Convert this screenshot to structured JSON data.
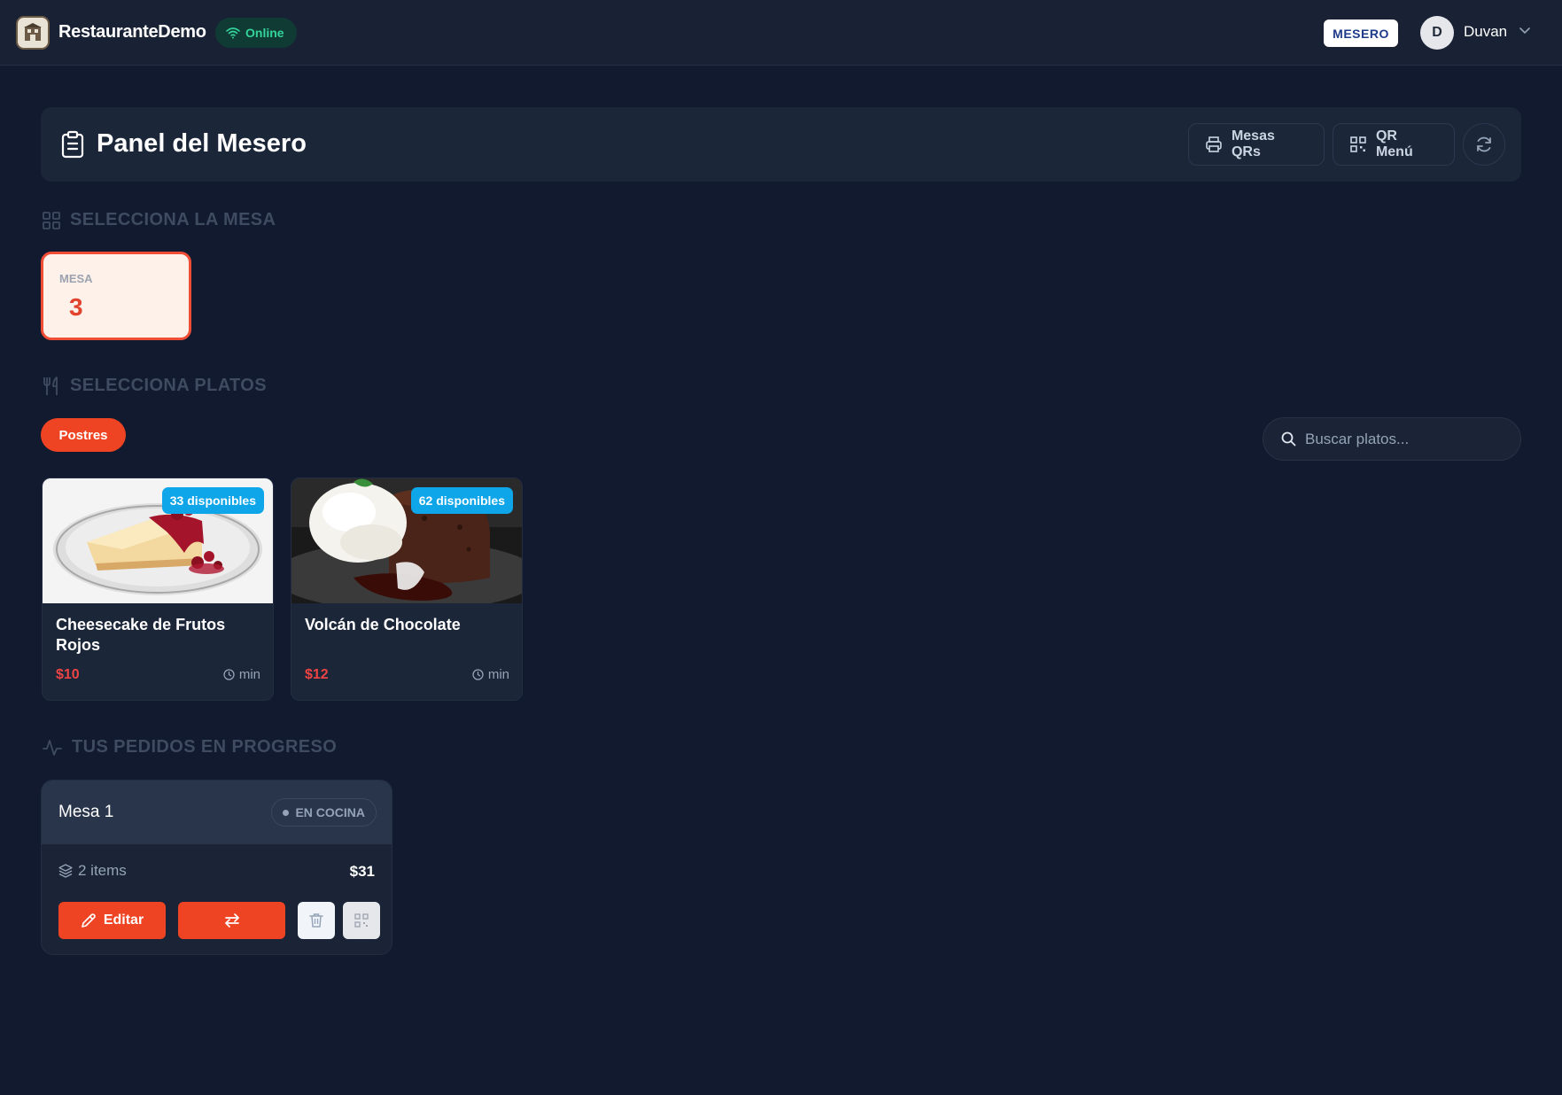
{
  "app": {
    "brand_name": "RestauranteDemo",
    "connection_status": "Online",
    "role_badge": "MESERO",
    "user_initial": "D",
    "user_name": "Duvan"
  },
  "header": {
    "title": "Panel del Mesero",
    "buttons": {
      "mesas_qrs": "Mesas QRs",
      "qr_menu": "QR Menú"
    }
  },
  "tables_section": {
    "heading": "SELECCIONA LA MESA",
    "selected_table": {
      "label": "MESA",
      "number": "3"
    }
  },
  "dishes_section": {
    "heading": "SELECCIONA PLATOS",
    "categories": [
      "Postres"
    ],
    "active_category": "Postres",
    "search": {
      "placeholder": "Buscar platos...",
      "value": ""
    },
    "dishes": [
      {
        "name": "Cheesecake de Frutos Rojos",
        "stock": "33 disponibles",
        "price": "$10",
        "time": "min"
      },
      {
        "name": "Volcán de Chocolate",
        "stock": "62 disponibles",
        "price": "$12",
        "time": "min"
      }
    ]
  },
  "orders_section": {
    "heading": "TUS PEDIDOS EN PROGRESO",
    "orders": [
      {
        "table": "Mesa 1",
        "status": "EN COCINA",
        "items": "2 items",
        "total": "$31",
        "edit_label": "Editar"
      }
    ]
  },
  "colors": {
    "accent": "#ef4423",
    "background": "#111a2e",
    "online_green": "#34d399",
    "stock_badge": "#0ea5e9",
    "price_red": "#ef4444"
  },
  "icons": {
    "online": "wifi-icon",
    "header": "clipboard-icon",
    "mesas_qrs": "printer-icon",
    "qr_menu": "qr-code-icon",
    "refresh": "refresh-icon",
    "tables_heading": "grid-icon",
    "dishes_heading": "utensils-icon",
    "orders_heading": "activity-icon",
    "search": "search-icon",
    "time": "clock-icon",
    "items": "layers-icon",
    "edit": "pencil-icon",
    "transfer": "arrows-swap-icon",
    "delete": "trash-icon",
    "qr": "qr-code-icon"
  }
}
